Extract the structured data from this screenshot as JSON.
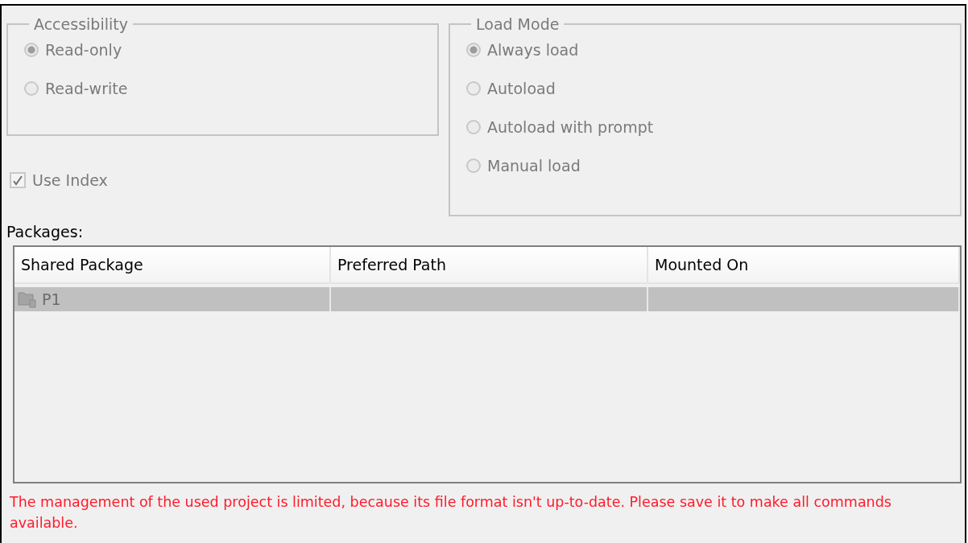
{
  "accessibility": {
    "title": "Accessibility",
    "disabled": true,
    "options": [
      {
        "label": "Read-only",
        "selected": true
      },
      {
        "label": "Read-write",
        "selected": false
      }
    ]
  },
  "use_index": {
    "label": "Use Index",
    "checked": true,
    "disabled": true
  },
  "load_mode": {
    "title": "Load Mode",
    "disabled": true,
    "options": [
      {
        "label": "Always load",
        "selected": true
      },
      {
        "label": "Autoload",
        "selected": false
      },
      {
        "label": "Autoload with prompt",
        "selected": false
      },
      {
        "label": "Manual load",
        "selected": false
      }
    ]
  },
  "packages": {
    "label": "Packages:",
    "columns": [
      "Shared Package",
      "Preferred Path",
      "Mounted On"
    ],
    "rows": [
      {
        "cells": [
          "P1",
          "",
          ""
        ],
        "selected": true,
        "disabled": true
      }
    ]
  },
  "warning": "The management of the used project is limited, because its file format isn't up-to-date. Please save it to make all commands available."
}
